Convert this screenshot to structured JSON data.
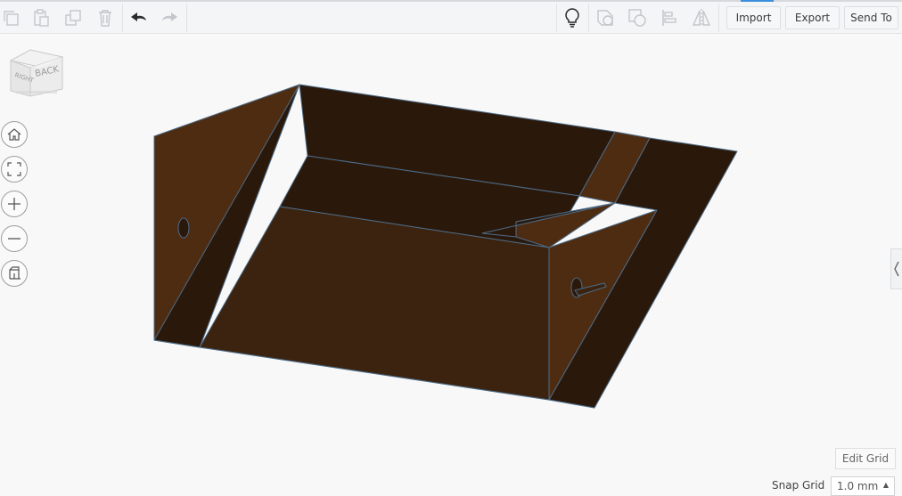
{
  "toolbar": {
    "import_label": "Import",
    "export_label": "Export",
    "send_to_label": "Send To",
    "icons": [
      "copy-icon",
      "paste-icon",
      "duplicate-icon",
      "delete-icon",
      "undo-icon",
      "redo-icon",
      "lightbulb-icon",
      "group-icon",
      "ungroup-icon",
      "align-icon",
      "mirror-icon"
    ]
  },
  "viewcube": {
    "right_face": "RIGHT",
    "back_face": "BACK"
  },
  "nav": [
    "home-icon",
    "fit-view-icon",
    "zoom-in-icon",
    "zoom-out-icon",
    "perspective-icon"
  ],
  "bottom": {
    "edit_grid_label": "Edit Grid",
    "snap_grid_label": "Snap Grid",
    "snap_grid_value": "1.0 mm"
  },
  "colors": {
    "model_light": "#4e2c11",
    "model_mid": "#3b230f",
    "model_dark": "#2a190b",
    "model_edge": "#4d6b87",
    "accent": "#3c8fde"
  }
}
